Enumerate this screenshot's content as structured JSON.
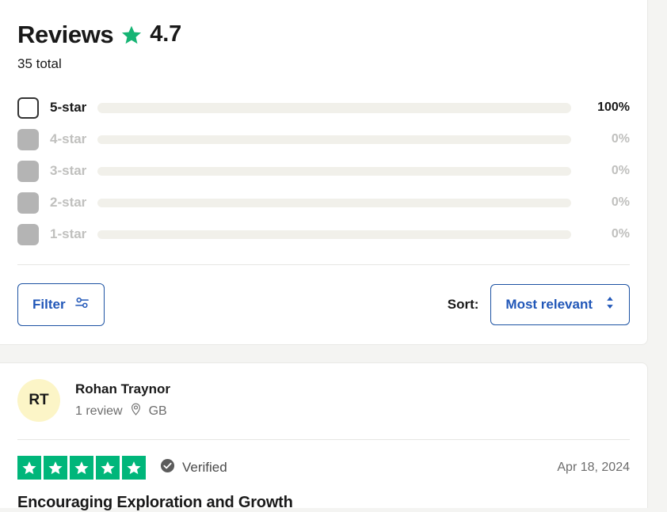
{
  "summary": {
    "title": "Reviews",
    "rating": "4.7",
    "star_icon": "star-icon",
    "total": "35 total",
    "distribution": [
      {
        "label": "5-star",
        "percent": "100%",
        "value": 100,
        "checkbox_state": "enabled"
      },
      {
        "label": "4-star",
        "percent": "0%",
        "value": 0,
        "checkbox_state": "disabled"
      },
      {
        "label": "3-star",
        "percent": "0%",
        "value": 0,
        "checkbox_state": "disabled"
      },
      {
        "label": "2-star",
        "percent": "0%",
        "value": 0,
        "checkbox_state": "disabled"
      },
      {
        "label": "1-star",
        "percent": "0%",
        "value": 0,
        "checkbox_state": "disabled"
      }
    ]
  },
  "controls": {
    "filter_label": "Filter",
    "filter_icon": "sliders-icon",
    "sort_label": "Sort:",
    "sort_value": "Most relevant",
    "sort_icon": "chevron-updown-icon"
  },
  "review": {
    "avatar_initials": "RT",
    "name": "Rohan Traynor",
    "review_count": "1 review",
    "location_icon": "location-pin-icon",
    "country": "GB",
    "stars": 5,
    "verified_icon": "check-circle-icon",
    "verified_label": "Verified",
    "date": "Apr 18, 2024",
    "title": "Encouraging Exploration and Growth"
  },
  "colors": {
    "brand_green": "#00b67a",
    "link_blue": "#2157b8",
    "bar_fill": "#191919",
    "bar_track": "#f1f0ea",
    "avatar_bg": "#fcf5c7",
    "page_bg": "#f4f4f2"
  }
}
